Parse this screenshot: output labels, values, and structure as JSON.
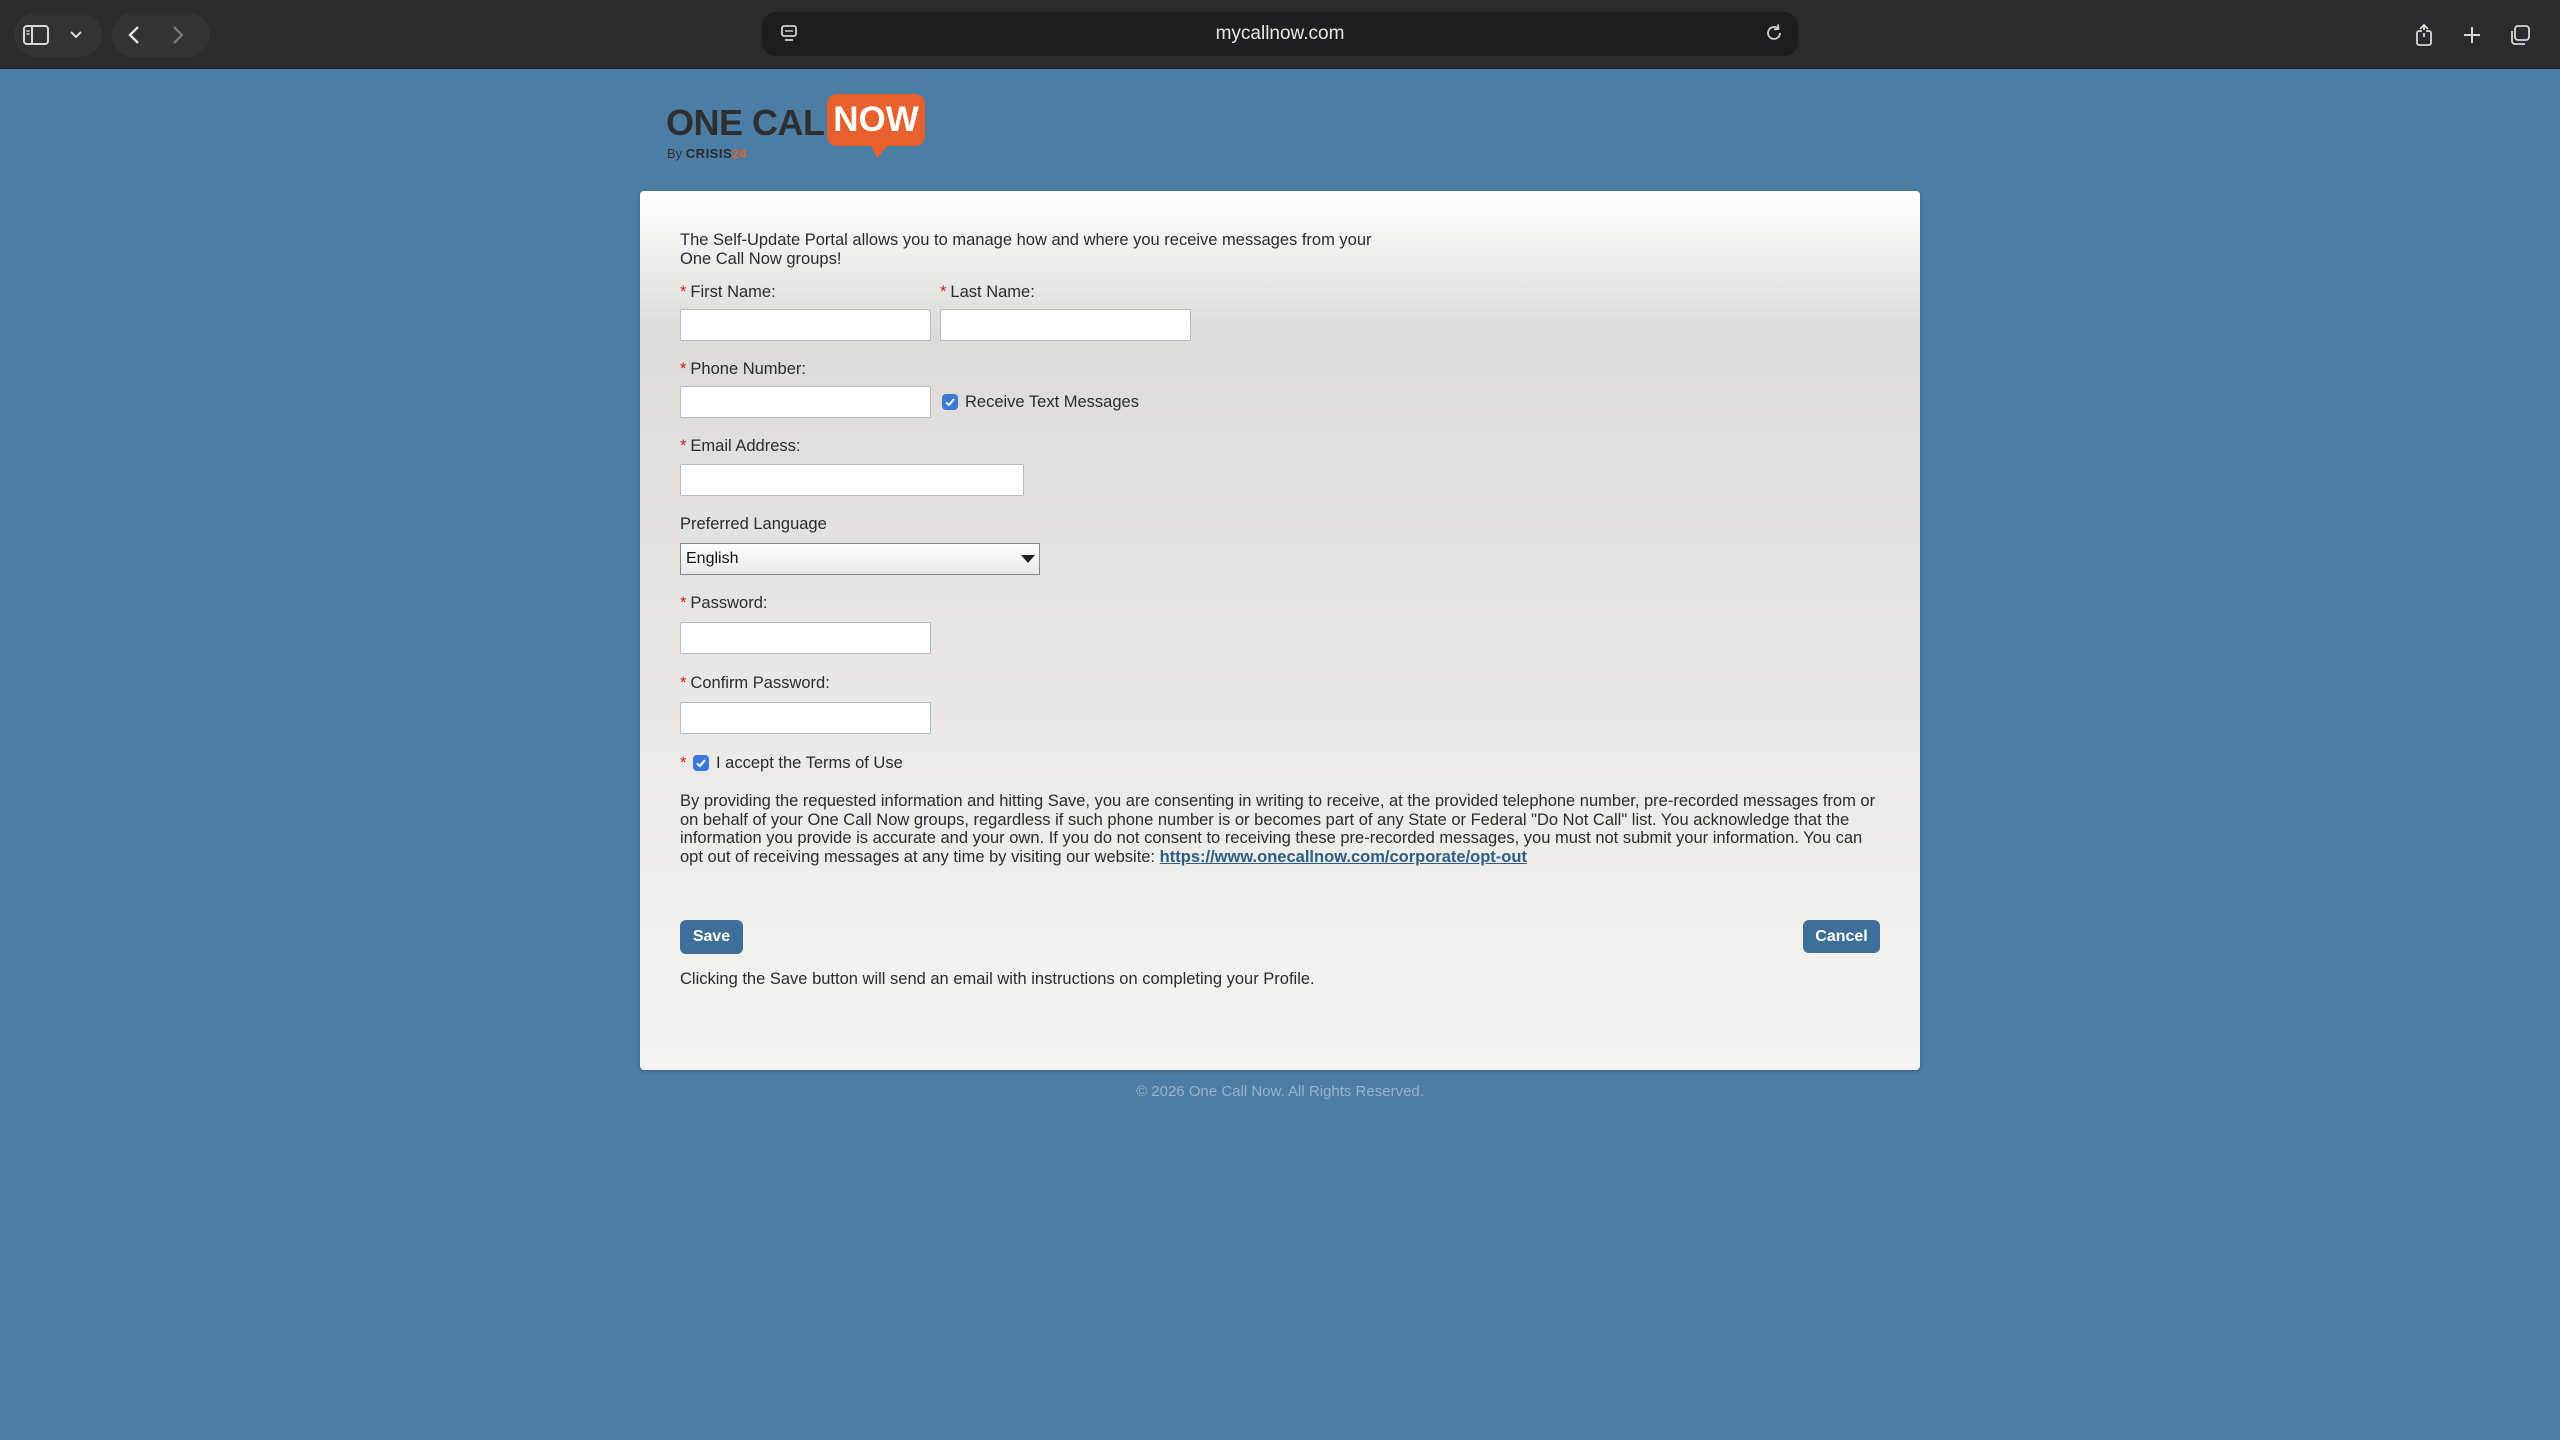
{
  "browser": {
    "url": "mycallnow.com"
  },
  "logo": {
    "one_call": "ONE CALL",
    "now": "NOW",
    "by": "By",
    "brand": "CRISIS",
    "brand_suffix": "24"
  },
  "form": {
    "intro": "The Self-Update Portal allows you to manage how and where you receive messages from your One Call Now groups!",
    "required_mark": "*",
    "first_name_label": "First Name:",
    "last_name_label": "Last Name:",
    "phone_label": "Phone Number:",
    "receive_text_label": "Receive Text Messages",
    "receive_text_checked": true,
    "email_label": "Email Address:",
    "language_label": "Preferred Language",
    "language_value": "English",
    "password_label": "Password:",
    "confirm_password_label": "Confirm Password:",
    "terms_label": "I accept the Terms of Use",
    "terms_checked": true,
    "consent_text": "By providing the requested information and hitting Save, you are consenting in writing to receive, at the provided telephone number, pre-recorded messages from or on behalf of your One Call Now groups, regardless if such phone number is or becomes part of any State or Federal \"Do Not Call\" list. You acknowledge that the information you provide is accurate and your own. If you do not consent to receiving these pre-recorded messages, you must not submit your information. You can opt out of receiving messages at any time by visiting our website:",
    "consent_link": "https://www.onecallnow.com/corporate/opt-out",
    "save_label": "Save",
    "cancel_label": "Cancel",
    "save_note": "Clicking the Save button will send an email with instructions on completing your Profile."
  },
  "footer": {
    "copyright": "© 2026 One Call Now. All Rights Reserved."
  },
  "colors": {
    "page_bg": "#4b7da5",
    "button": "#3d6f98",
    "logo_orange": "#e8612c",
    "required": "#d02020",
    "checkbox": "#3b78d8"
  }
}
